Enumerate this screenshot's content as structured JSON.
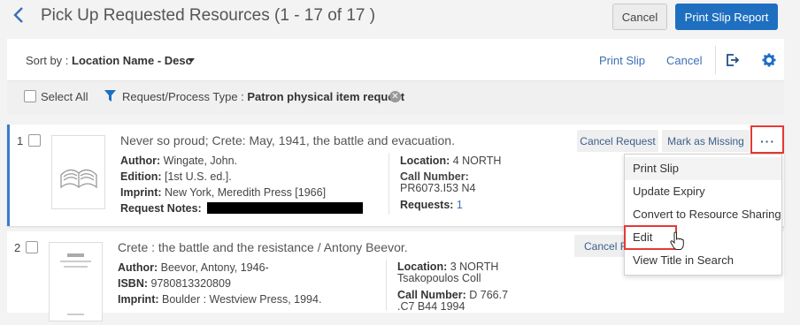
{
  "header": {
    "back_icon": "chevron-left-icon",
    "title": "Pick Up Requested Resources (1 - 17 of 17 )",
    "cancel_label": "Cancel",
    "print_slip_report_label": "Print Slip Report"
  },
  "toolbar": {
    "sort_prefix": "Sort by : ",
    "sort_value": "Location Name - Desc",
    "print_slip_label": "Print Slip",
    "cancel_label": "Cancel",
    "export_icon": "export-icon",
    "settings_icon": "gear-icon"
  },
  "filter": {
    "select_all_label": "Select All",
    "filter_prefix": "Request/Process Type : ",
    "filter_value": "Patron physical item request"
  },
  "items": [
    {
      "number": "1",
      "title": "Never so proud; Crete: May, 1941, the battle and evacuation.",
      "author_label": "Author:",
      "author": "Wingate, John.",
      "edition_label": "Edition:",
      "edition": "[1st U.S. ed.].",
      "imprint_label": "Imprint:",
      "imprint": "New York, Meredith Press [1966]",
      "notes_label": "Request Notes:",
      "location_label": "Location:",
      "location": "4 NORTH",
      "call_number_label": "Call Number:",
      "call_number": "PR6073.I53 N4",
      "requests_label": "Requests:",
      "requests": "1",
      "cancel_request_label": "Cancel Request",
      "mark_missing_label": "Mark as Missing",
      "more_label": "···"
    },
    {
      "number": "2",
      "title": "Crete : the battle and the resistance / Antony Beevor.",
      "author_label": "Author:",
      "author": "Beevor, Antony, 1946-",
      "isbn_label": "ISBN:",
      "isbn": "9780813320809",
      "imprint_label": "Imprint:",
      "imprint": "Boulder : Westview Press, 1994.",
      "location_label": "Location:",
      "location": "3 NORTH",
      "location_sub": "Tsakopoulos Coll",
      "call_number_label": "Call Number:",
      "call_number": "D 766.7",
      "call_number_2": ".C7 B44 1994",
      "cancel_request_label": "Cancel Re"
    }
  ],
  "menu": {
    "items": [
      "Print Slip",
      "Update Expiry",
      "Convert to Resource Sharing",
      "Edit",
      "View Title in Search"
    ],
    "highlighted": "Edit"
  },
  "colors": {
    "primary": "#1f6fc1",
    "link": "#3b6fb6",
    "highlight_outline": "#e53935",
    "selected_row_accent": "#3b7bc8"
  }
}
